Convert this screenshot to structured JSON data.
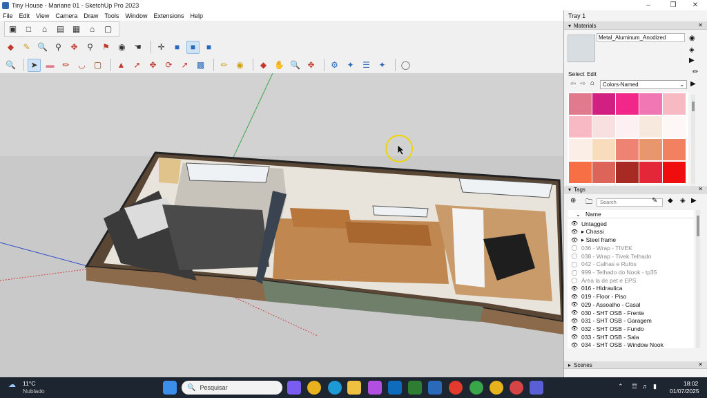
{
  "window": {
    "title": "Tiny House - Mariane 01 - SketchUp Pro 2023"
  },
  "menu": [
    "File",
    "Edit",
    "View",
    "Camera",
    "Draw",
    "Tools",
    "Window",
    "Extensions",
    "Help"
  ],
  "tray": {
    "title": "Tray 1",
    "materials": {
      "header": "Materials",
      "current_name": "Metal_Aluminum_Anodized",
      "select_tab": "Select",
      "edit_tab": "Edit",
      "library": "Colors-Named",
      "swatches": [
        "#e07a8c",
        "#d11f82",
        "#f1278a",
        "#ef77b3",
        "#f7b9c2",
        "#f8b9c4",
        "#f9e0e0",
        "#fcf0f2",
        "#f8e9de",
        "#fdf8f6",
        "#fbeee6",
        "#f9dcbe",
        "#ef8373",
        "#e8966e",
        "#f18160",
        "#f76f44",
        "#dc6458",
        "#a72a25",
        "#e32638",
        "#ef0d0d"
      ]
    },
    "tags": {
      "header": "Tags",
      "search_placeholder": "Search",
      "name_col": "Name",
      "items": [
        {
          "label": "Untagged",
          "visible": true
        },
        {
          "label": "▸  Chassi",
          "visible": true
        },
        {
          "label": "▸  Steel frame",
          "visible": true
        },
        {
          "label": "036 - Wrap - TIVEK",
          "visible": false
        },
        {
          "label": "038 - Wrap  - Tivek Telhado",
          "visible": false
        },
        {
          "label": "042 - Calhas e Rufos",
          "visible": false
        },
        {
          "label": "999 - Telhado do Nook - tp35",
          "visible": false
        },
        {
          "label": "Área la de pet e EPS",
          "visible": false
        },
        {
          "label": "016 - Hidraulica",
          "visible": true
        },
        {
          "label": "019 - Floor - Piso",
          "visible": true
        },
        {
          "label": "029 - Assoalho -  Casal",
          "visible": true
        },
        {
          "label": "030 - SHT OSB - Frente",
          "visible": true
        },
        {
          "label": "031 - SHT OSB - Garagem",
          "visible": true
        },
        {
          "label": "032 - SHT OSB - Fundo",
          "visible": true
        },
        {
          "label": "033 - SHT OSB - Sala",
          "visible": true
        },
        {
          "label": "034 - SHT OSB - Window Nook",
          "visible": true
        }
      ]
    },
    "scenes": {
      "header": "Scenes"
    }
  },
  "taskbar": {
    "weather_temp": "11°C",
    "weather_desc": "Nublado",
    "search_placeholder": "Pesquisar",
    "time": "18:02",
    "date": "01/07/2025"
  }
}
